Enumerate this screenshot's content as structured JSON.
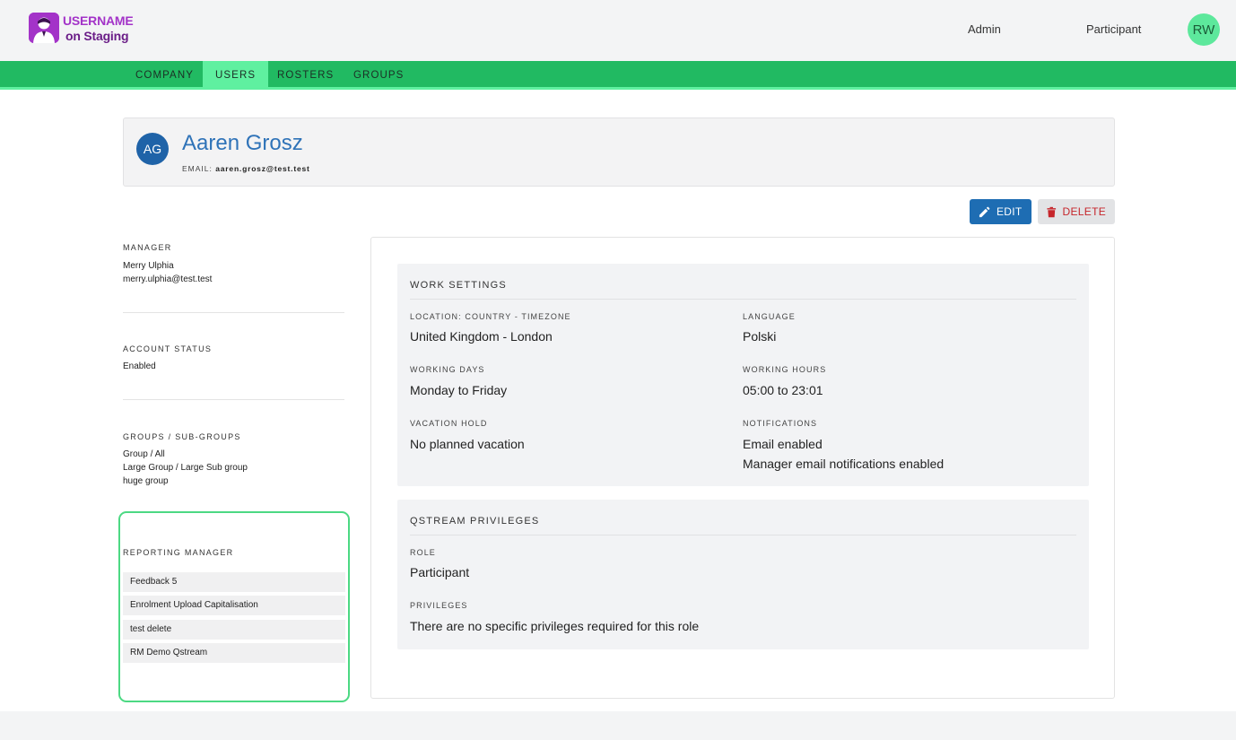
{
  "brand": {
    "line1": "USERNAME",
    "line2": "on Staging"
  },
  "top_nav": {
    "admin": "Admin",
    "participant": "Participant",
    "avatar_initials": "RW"
  },
  "tabs": [
    {
      "label": "COMPANY"
    },
    {
      "label": "USERS",
      "active": true
    },
    {
      "label": "ROSTERS"
    },
    {
      "label": "GROUPS"
    }
  ],
  "user": {
    "initials": "AG",
    "name": "Aaren Grosz",
    "email_label": "EMAIL:",
    "email": "aaren.grosz@test.test"
  },
  "actions": {
    "edit": "EDIT",
    "delete": "DELETE"
  },
  "sidebar": {
    "manager_label": "MANAGER",
    "manager_name": "Merry Ulphia",
    "manager_email": "merry.ulphia@test.test",
    "account_status_label": "ACCOUNT STATUS",
    "account_status": "Enabled",
    "groups_label": "GROUPS / SUB-GROUPS",
    "groups": [
      "Group / All",
      "Large Group / Large Sub group",
      "huge group"
    ],
    "reporting_manager_label": "REPORTING MANAGER",
    "reporting_managers": [
      "Feedback 5",
      "Enrolment Upload Capitalisation",
      "test delete",
      "RM Demo Qstream"
    ]
  },
  "work_settings": {
    "title": "WORK SETTINGS",
    "location_label": "LOCATION: COUNTRY - TIMEZONE",
    "location": "United Kingdom - London",
    "language_label": "LANGUAGE",
    "language": "Polski",
    "working_days_label": "WORKING DAYS",
    "working_days": "Monday to Friday",
    "working_hours_label": "WORKING HOURS",
    "working_hours": "05:00 to 23:01",
    "vacation_label": "VACATION HOLD",
    "vacation": "No planned vacation",
    "notifications_label": "NOTIFICATIONS",
    "notifications": [
      "Email enabled",
      "Manager email notifications enabled"
    ]
  },
  "privileges": {
    "title": "QSTREAM PRIVILEGES",
    "role_label": "ROLE",
    "role": "Participant",
    "privileges_label": "PRIVILEGES",
    "privileges": "There are no specific privileges required for this role"
  },
  "colors": {
    "nav_green": "#21ba62",
    "active_tab": "#5ff0a0",
    "edit_blue": "#1e6db3",
    "delete_red": "#c6252b",
    "name_blue": "#2f73b8",
    "brand_purple": "#a333c8"
  }
}
